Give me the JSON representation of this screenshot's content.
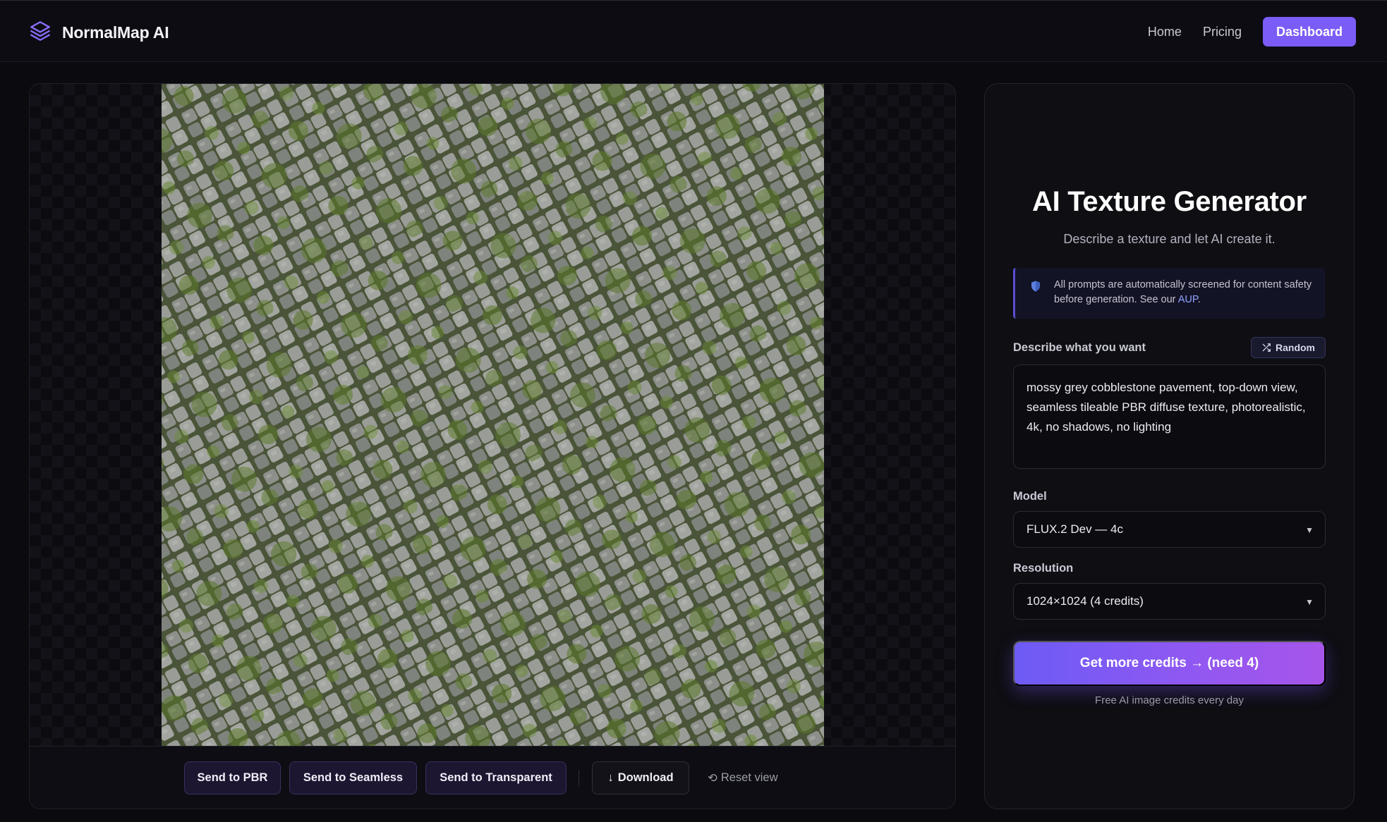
{
  "header": {
    "brand_name": "NormalMap AI",
    "nav": {
      "home": "Home",
      "pricing": "Pricing",
      "dashboard": "Dashboard"
    }
  },
  "preview": {
    "image_alt": "mossy grey cobblestone texture",
    "toolbar": {
      "send_pbr": "Send to PBR",
      "send_seamless": "Send to Seamless",
      "send_transparent": "Send to Transparent",
      "download": "Download",
      "reset_view": "Reset view"
    }
  },
  "generator": {
    "title": "AI Texture Generator",
    "subtitle": "Describe a texture and let AI create it.",
    "notice": {
      "text": "All prompts are automatically screened for content safety before generation. See our ",
      "link": "AUP",
      "suffix": "."
    },
    "prompt_label": "Describe what you want",
    "random_label": "Random",
    "prompt_value": "mossy grey cobblestone pavement, top-down view, seamless tileable PBR diffuse texture, photorealistic, 4k, no shadows, no lighting",
    "model_label": "Model",
    "model_value": "FLUX.2 Dev — 4c",
    "resolution_label": "Resolution",
    "resolution_value": "1024×1024 (4 credits)",
    "cta_label": "Get more credits → (need 4)",
    "cta_note": "Free AI image credits every day"
  },
  "colors": {
    "accent": "#7c5cf6",
    "background": "#0a0a0f",
    "panel": "#0e0e13"
  },
  "icons": {
    "brand": "layers-icon",
    "notice": "shield-icon",
    "random": "shuffle-icon",
    "download": "arrow-down-icon",
    "reset": "rotate-ccw-icon",
    "select": "chevron-down-icon"
  }
}
